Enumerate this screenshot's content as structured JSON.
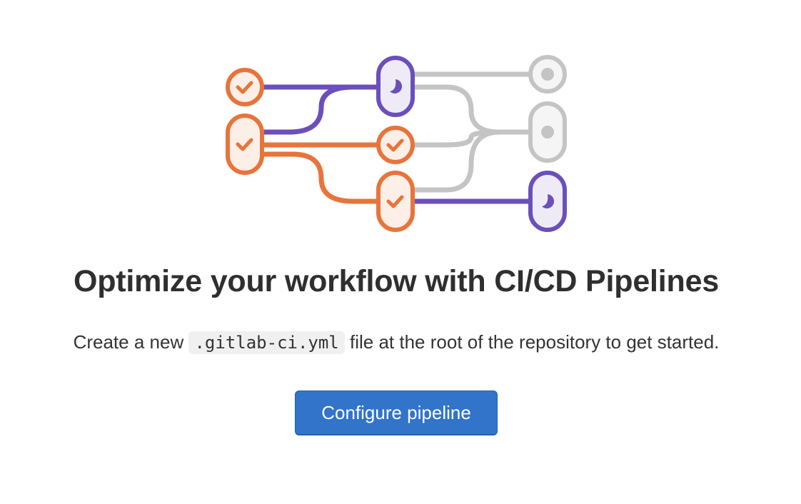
{
  "empty_state": {
    "title": "Optimize your workflow with CI/CD Pipelines",
    "description_before": "Create a new",
    "description_code": ".gitlab-ci.yml",
    "description_after": "file at the root of the repository to get started.",
    "button_label": "Configure pipeline"
  },
  "illustration": {
    "icons": [
      "check-icon",
      "running-icon",
      "pending-icon"
    ],
    "colors": {
      "success": "#e8743b",
      "success_fill": "#fcefe8",
      "running": "#6b4fbb",
      "running_fill": "#eeebf7",
      "pending": "#c4c4c4",
      "pending_fill": "#f5f5f5"
    }
  },
  "button_color": "#3174c9"
}
